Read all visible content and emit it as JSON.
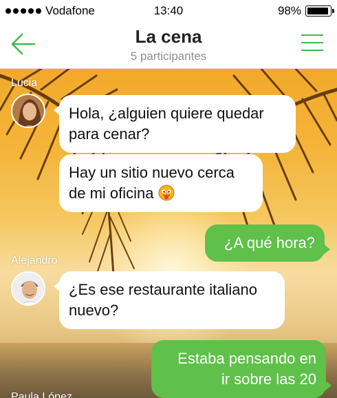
{
  "status_bar": {
    "carrier": "Vodafone",
    "time": "13:40",
    "battery": "98%",
    "battery_level": 0.98
  },
  "header": {
    "title": "La cena",
    "subtitle": "5 participantes",
    "back_icon": "back-arrow-icon",
    "menu_icon": "hamburger-menu-icon",
    "accent_color": "#3fb950"
  },
  "messages": [
    {
      "sender": "Lucia",
      "text_lines": [
        "Hola, ¿alguien quiere quedar",
        "para cenar?"
      ],
      "direction": "in"
    },
    {
      "sender": "Lucia",
      "text_lines": [
        "Hay un sitio nuevo cerca",
        "de mi oficina"
      ],
      "direction": "in",
      "emoji": "tongue-out-emoji"
    },
    {
      "sender": "",
      "text_lines": [
        "¿A qué hora?"
      ],
      "direction": "out"
    },
    {
      "sender": "Alejandro",
      "text_lines": [
        "¿Es ese restaurante italiano",
        "nuevo?"
      ],
      "direction": "in"
    },
    {
      "sender": "",
      "text_lines": [
        "Estaba pensando en",
        "ir sobre las 20"
      ],
      "direction": "out"
    },
    {
      "sender": "Paula López",
      "text_lines": [],
      "direction": "in"
    }
  ],
  "colors": {
    "incoming_bubble": "#ffffff",
    "outgoing_bubble": "#5fc04a"
  }
}
